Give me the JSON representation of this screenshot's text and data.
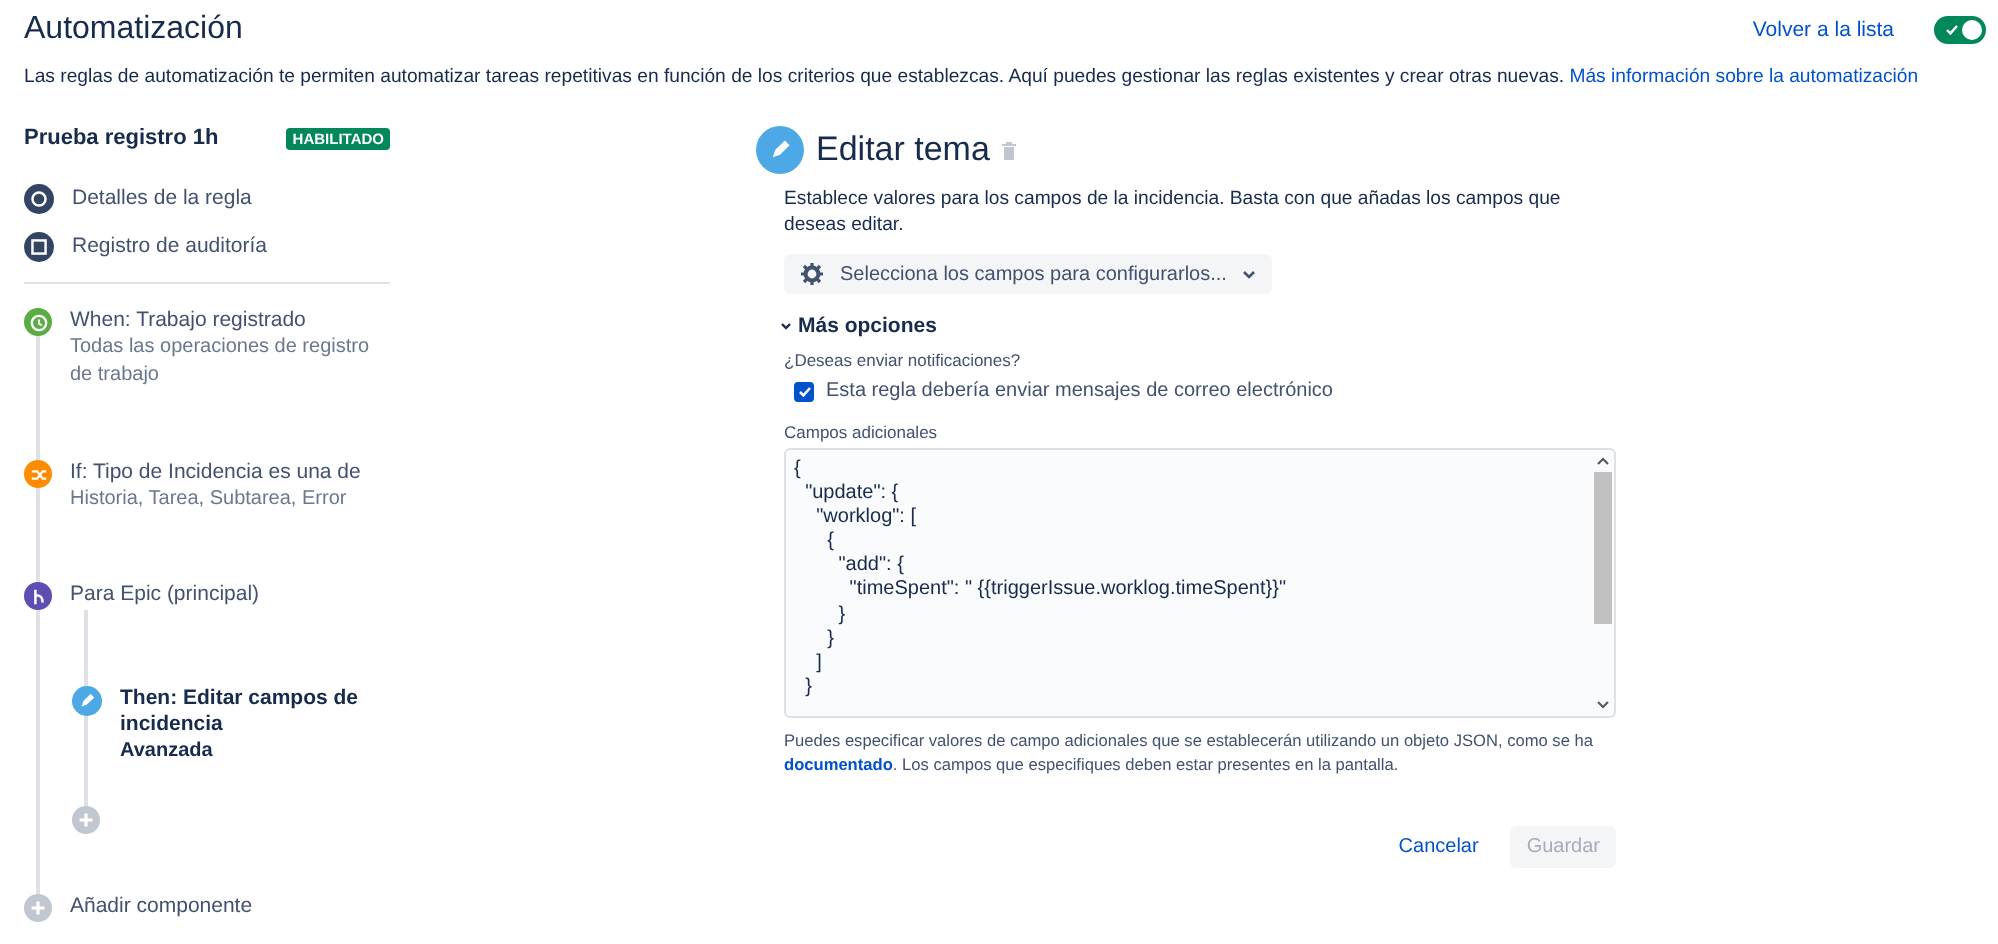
{
  "header": {
    "title": "Automatización",
    "back_link": "Volver a la lista",
    "toggle": {
      "on": true
    },
    "description": "Las reglas de automatización te permiten automatizar tareas repetitivas en función de los criterios que establezcas. Aquí puedes gestionar las reglas existentes y crear otras nuevas.",
    "description_link": "Más información sobre la automatización"
  },
  "rule": {
    "name": "Prueba registro 1h",
    "status": "HABILITADO",
    "links": [
      {
        "kind": "details",
        "label": "Detalles de la regla"
      },
      {
        "kind": "audit",
        "label": "Registro de auditoría"
      }
    ]
  },
  "steps": [
    {
      "kind": "trigger",
      "title": "When: Trabajo registrado",
      "detail": "Todas las operaciones de registro de trabajo",
      "selected": false
    },
    {
      "kind": "condition",
      "title": "If: Tipo de Incidencia es una de",
      "detail": "Historia, Tarea, Subtarea, Error",
      "selected": false
    },
    {
      "kind": "branch",
      "title": "Para Epic (principal)",
      "selected": false,
      "children": [
        {
          "kind": "action",
          "title": "Then: Editar campos de incidencia",
          "detail": "Avanzada",
          "selected": true
        },
        {
          "kind": "add"
        }
      ]
    },
    {
      "kind": "add",
      "title": "Añadir componente"
    }
  ],
  "editor": {
    "title": "Editar tema",
    "description": "Establece valores para los campos de la incidencia. Basta con que añadas los campos que deseas editar.",
    "field_select": "Selecciona los campos para configurarlos...",
    "more_options": {
      "label": "Más opciones",
      "expanded": true
    },
    "notify_question": "¿Deseas enviar notificaciones?",
    "notify": {
      "label": "Esta regla debería enviar mensajes de correo electrónico",
      "checked": true
    },
    "additional_label": "Campos adicionales",
    "additional_json": [
      "{",
      "  \"update\": {",
      "    \"worklog\": [",
      "      {",
      "        \"add\": {",
      "          \"timeSpent\": \" {{triggerIssue.worklog.timeSpent}}\"",
      "        }",
      "      }",
      "    ]",
      "  }"
    ],
    "help_before": "Puedes especificar valores de campo adicionales que se establecerán utilizando un objeto JSON, como se ha",
    "help_link": "documentado",
    "help_after": ". Los campos que especifiques deben estar presentes en la pantalla.",
    "buttons": [
      {
        "kind": "link",
        "label": "Cancelar",
        "disabled": false
      },
      {
        "kind": "primary",
        "label": "Guardar",
        "disabled": true
      }
    ]
  }
}
